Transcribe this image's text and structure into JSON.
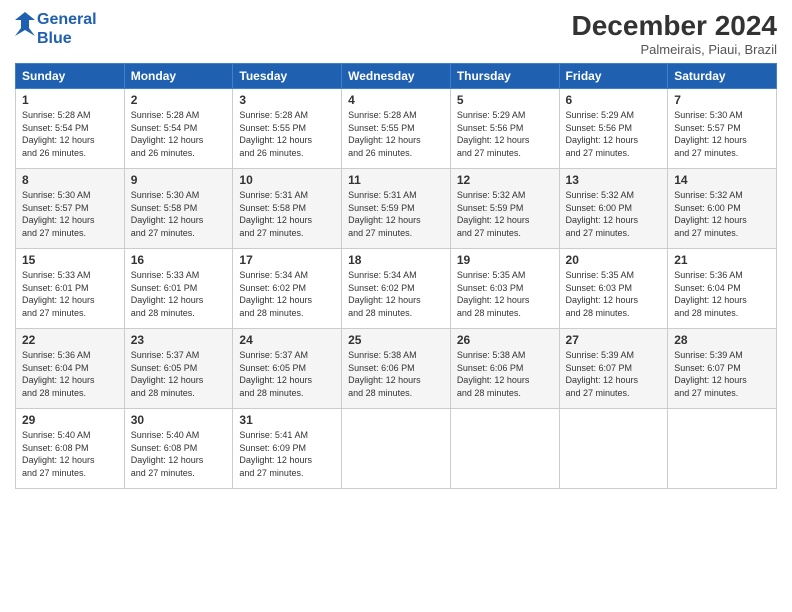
{
  "header": {
    "logo_line1": "General",
    "logo_line2": "Blue",
    "month": "December 2024",
    "location": "Palmeirais, Piaui, Brazil"
  },
  "weekdays": [
    "Sunday",
    "Monday",
    "Tuesday",
    "Wednesday",
    "Thursday",
    "Friday",
    "Saturday"
  ],
  "weeks": [
    [
      {
        "day": "1",
        "info": "Sunrise: 5:28 AM\nSunset: 5:54 PM\nDaylight: 12 hours\nand 26 minutes."
      },
      {
        "day": "2",
        "info": "Sunrise: 5:28 AM\nSunset: 5:54 PM\nDaylight: 12 hours\nand 26 minutes."
      },
      {
        "day": "3",
        "info": "Sunrise: 5:28 AM\nSunset: 5:55 PM\nDaylight: 12 hours\nand 26 minutes."
      },
      {
        "day": "4",
        "info": "Sunrise: 5:28 AM\nSunset: 5:55 PM\nDaylight: 12 hours\nand 26 minutes."
      },
      {
        "day": "5",
        "info": "Sunrise: 5:29 AM\nSunset: 5:56 PM\nDaylight: 12 hours\nand 27 minutes."
      },
      {
        "day": "6",
        "info": "Sunrise: 5:29 AM\nSunset: 5:56 PM\nDaylight: 12 hours\nand 27 minutes."
      },
      {
        "day": "7",
        "info": "Sunrise: 5:30 AM\nSunset: 5:57 PM\nDaylight: 12 hours\nand 27 minutes."
      }
    ],
    [
      {
        "day": "8",
        "info": "Sunrise: 5:30 AM\nSunset: 5:57 PM\nDaylight: 12 hours\nand 27 minutes."
      },
      {
        "day": "9",
        "info": "Sunrise: 5:30 AM\nSunset: 5:58 PM\nDaylight: 12 hours\nand 27 minutes."
      },
      {
        "day": "10",
        "info": "Sunrise: 5:31 AM\nSunset: 5:58 PM\nDaylight: 12 hours\nand 27 minutes."
      },
      {
        "day": "11",
        "info": "Sunrise: 5:31 AM\nSunset: 5:59 PM\nDaylight: 12 hours\nand 27 minutes."
      },
      {
        "day": "12",
        "info": "Sunrise: 5:32 AM\nSunset: 5:59 PM\nDaylight: 12 hours\nand 27 minutes."
      },
      {
        "day": "13",
        "info": "Sunrise: 5:32 AM\nSunset: 6:00 PM\nDaylight: 12 hours\nand 27 minutes."
      },
      {
        "day": "14",
        "info": "Sunrise: 5:32 AM\nSunset: 6:00 PM\nDaylight: 12 hours\nand 27 minutes."
      }
    ],
    [
      {
        "day": "15",
        "info": "Sunrise: 5:33 AM\nSunset: 6:01 PM\nDaylight: 12 hours\nand 27 minutes."
      },
      {
        "day": "16",
        "info": "Sunrise: 5:33 AM\nSunset: 6:01 PM\nDaylight: 12 hours\nand 28 minutes."
      },
      {
        "day": "17",
        "info": "Sunrise: 5:34 AM\nSunset: 6:02 PM\nDaylight: 12 hours\nand 28 minutes."
      },
      {
        "day": "18",
        "info": "Sunrise: 5:34 AM\nSunset: 6:02 PM\nDaylight: 12 hours\nand 28 minutes."
      },
      {
        "day": "19",
        "info": "Sunrise: 5:35 AM\nSunset: 6:03 PM\nDaylight: 12 hours\nand 28 minutes."
      },
      {
        "day": "20",
        "info": "Sunrise: 5:35 AM\nSunset: 6:03 PM\nDaylight: 12 hours\nand 28 minutes."
      },
      {
        "day": "21",
        "info": "Sunrise: 5:36 AM\nSunset: 6:04 PM\nDaylight: 12 hours\nand 28 minutes."
      }
    ],
    [
      {
        "day": "22",
        "info": "Sunrise: 5:36 AM\nSunset: 6:04 PM\nDaylight: 12 hours\nand 28 minutes."
      },
      {
        "day": "23",
        "info": "Sunrise: 5:37 AM\nSunset: 6:05 PM\nDaylight: 12 hours\nand 28 minutes."
      },
      {
        "day": "24",
        "info": "Sunrise: 5:37 AM\nSunset: 6:05 PM\nDaylight: 12 hours\nand 28 minutes."
      },
      {
        "day": "25",
        "info": "Sunrise: 5:38 AM\nSunset: 6:06 PM\nDaylight: 12 hours\nand 28 minutes."
      },
      {
        "day": "26",
        "info": "Sunrise: 5:38 AM\nSunset: 6:06 PM\nDaylight: 12 hours\nand 28 minutes."
      },
      {
        "day": "27",
        "info": "Sunrise: 5:39 AM\nSunset: 6:07 PM\nDaylight: 12 hours\nand 27 minutes."
      },
      {
        "day": "28",
        "info": "Sunrise: 5:39 AM\nSunset: 6:07 PM\nDaylight: 12 hours\nand 27 minutes."
      }
    ],
    [
      {
        "day": "29",
        "info": "Sunrise: 5:40 AM\nSunset: 6:08 PM\nDaylight: 12 hours\nand 27 minutes."
      },
      {
        "day": "30",
        "info": "Sunrise: 5:40 AM\nSunset: 6:08 PM\nDaylight: 12 hours\nand 27 minutes."
      },
      {
        "day": "31",
        "info": "Sunrise: 5:41 AM\nSunset: 6:09 PM\nDaylight: 12 hours\nand 27 minutes."
      },
      {
        "day": "",
        "info": ""
      },
      {
        "day": "",
        "info": ""
      },
      {
        "day": "",
        "info": ""
      },
      {
        "day": "",
        "info": ""
      }
    ]
  ]
}
